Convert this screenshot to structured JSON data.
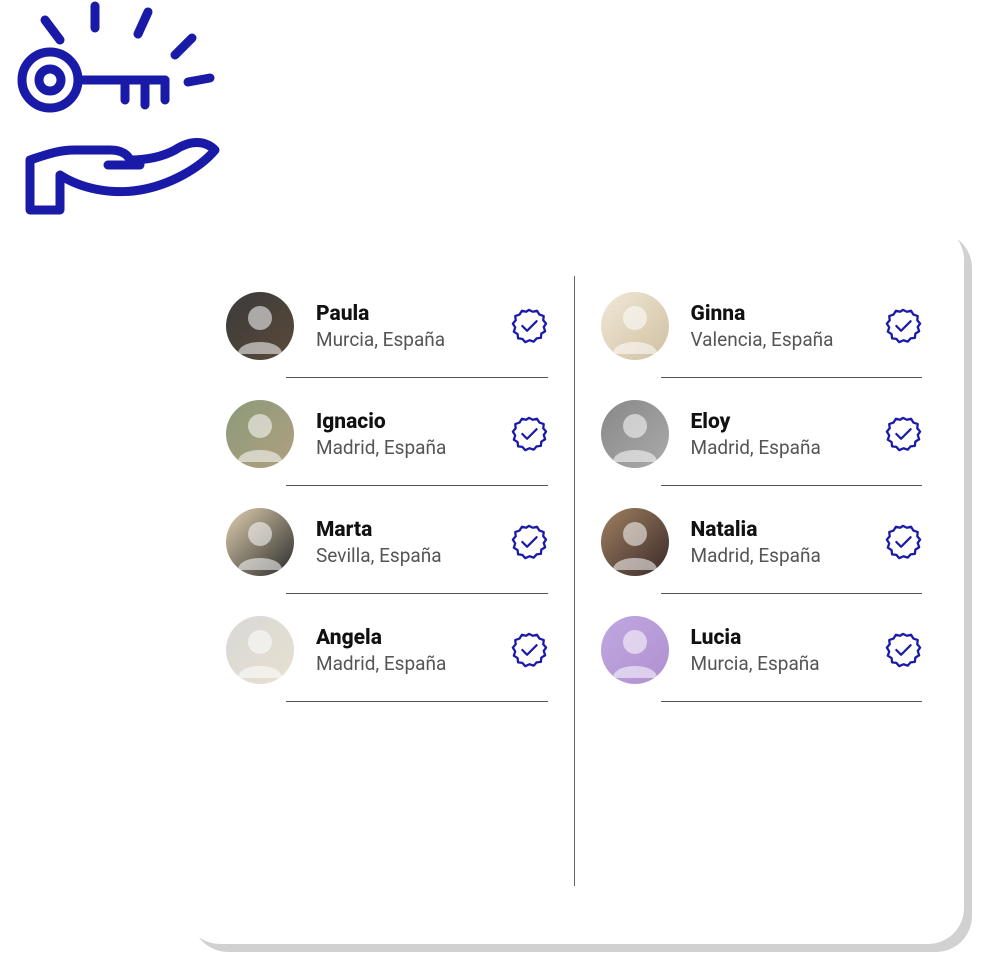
{
  "people_left": [
    {
      "name": "Paula",
      "location": " Murcia, España",
      "avatar_bg": "linear-gradient(135deg,#3a3a3a,#5a4a3a)"
    },
    {
      "name": "Ignacio",
      "location": " Madrid, España",
      "avatar_bg": "linear-gradient(135deg,#8a9a7a,#b0a080)"
    },
    {
      "name": "Marta",
      "location": " Sevilla, España",
      "avatar_bg": "linear-gradient(135deg,#e0d0b0,#2a2a2a)"
    },
    {
      "name": "Angela",
      "location": " Madrid, España",
      "avatar_bg": "linear-gradient(135deg,#d8d8d8,#e8e0d0)"
    }
  ],
  "people_right": [
    {
      "name": "Ginna",
      "location": "Valencia, España",
      "avatar_bg": "linear-gradient(135deg,#f0e8d8,#d0c0a0)"
    },
    {
      "name": "Eloy",
      "location": "Madrid, España",
      "avatar_bg": "linear-gradient(135deg,#888,#aaa)"
    },
    {
      "name": "Natalia",
      "location": "Madrid, España",
      "avatar_bg": "linear-gradient(135deg,#a08060,#3a2a2a)"
    },
    {
      "name": "Lucia",
      "location": " Murcia, España",
      "avatar_bg": "linear-gradient(135deg,#c0a8e0,#b090d0)"
    }
  ],
  "brand_color": "#1a1aa8"
}
